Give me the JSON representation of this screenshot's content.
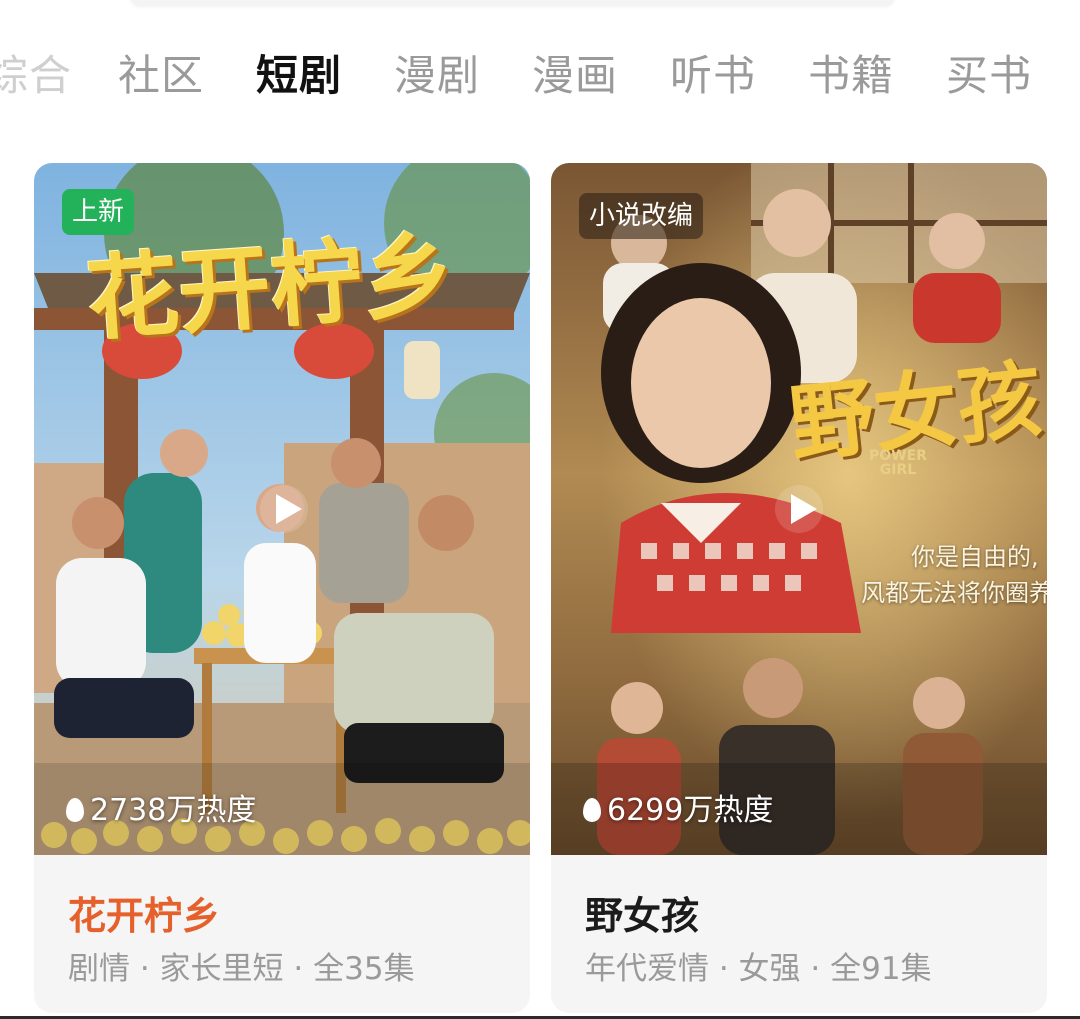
{
  "tabs": [
    "综合",
    "社区",
    "短剧",
    "漫剧",
    "漫画",
    "听书",
    "书籍",
    "买书"
  ],
  "active_tab": "短剧",
  "cards": [
    {
      "badge": "上新",
      "poster_title": "花开柠乡",
      "heat": "2738万热度",
      "title": "花开柠乡",
      "meta": "剧情 · 家长里短 · 全35集"
    },
    {
      "badge": "小说改编",
      "poster_title": "野女孩",
      "poster_subtitle": "POWER GIRL",
      "poster_slogan": [
        "你是自由的,",
        "风都无法将你圈养"
      ],
      "heat": "6299万热度",
      "title": "野女孩",
      "meta": "年代爱情 · 女强 · 全91集"
    }
  ],
  "colors": {
    "accent_title": "#e5602a",
    "badge_new": "#23b25a",
    "active_tab": "#111111",
    "inactive_tab": "#9a9a9a"
  },
  "icons": [
    "play-icon",
    "fire-icon"
  ]
}
